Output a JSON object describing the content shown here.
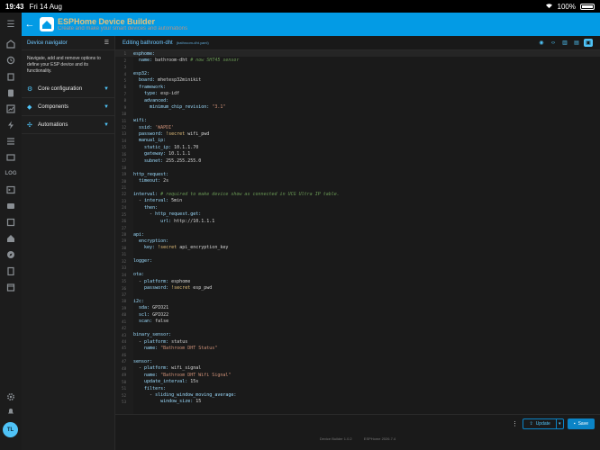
{
  "status": {
    "time": "19:43",
    "date": "Fri 14 Aug",
    "battery": "100%"
  },
  "header": {
    "title": "ESPHome Device Builder",
    "subtitle": "Create and make your smart devices and automations"
  },
  "nav": {
    "title": "Device navigator",
    "description": "Navigate, add and remove options to define your ESP device and its functionality.",
    "items": [
      {
        "label": "Core configuration"
      },
      {
        "label": "Components"
      },
      {
        "label": "Automations"
      }
    ]
  },
  "editor": {
    "title": "Editing bathroom-dht",
    "file": "(bathroom-dht.yaml)"
  },
  "footer": {
    "update_label": "Update",
    "save_label": "Save",
    "builder_version": "Device Builder 1.0.2",
    "esphome_version": "ESPHome 2026.7.4"
  },
  "user": {
    "initials": "TL"
  },
  "code_lines": [
    [
      [
        "k",
        "esphome:"
      ]
    ],
    [
      [
        "k",
        "  name: "
      ],
      [
        "v",
        "bathroom-dht "
      ],
      [
        "c",
        "# now SHT45 sensor"
      ]
    ],
    [],
    [
      [
        "k",
        "esp32:"
      ]
    ],
    [
      [
        "k",
        "  board: "
      ],
      [
        "v",
        "mhetesp32minikit"
      ]
    ],
    [
      [
        "k",
        "  framework:"
      ]
    ],
    [
      [
        "k",
        "    type: "
      ],
      [
        "v",
        "esp-idf"
      ]
    ],
    [
      [
        "k",
        "    advanced:"
      ]
    ],
    [
      [
        "k",
        "      minimum_chip_revision: "
      ],
      [
        "s",
        "\"3.1\""
      ]
    ],
    [],
    [
      [
        "k",
        "wifi:"
      ]
    ],
    [
      [
        "k",
        "  ssid: "
      ],
      [
        "s",
        "'WAPDI'"
      ]
    ],
    [
      [
        "k",
        "  password: "
      ],
      [
        "t",
        "!secret "
      ],
      [
        "v",
        "wifi_pwd"
      ]
    ],
    [
      [
        "k",
        "  manual_ip:"
      ]
    ],
    [
      [
        "k",
        "    static_ip: "
      ],
      [
        "v",
        "10.1.1.70"
      ]
    ],
    [
      [
        "k",
        "    gateway: "
      ],
      [
        "v",
        "10.1.1.1"
      ]
    ],
    [
      [
        "k",
        "    subnet: "
      ],
      [
        "v",
        "255.255.255.0"
      ]
    ],
    [],
    [
      [
        "k",
        "http_request:"
      ]
    ],
    [
      [
        "k",
        "  timeout: "
      ],
      [
        "v",
        "2s"
      ]
    ],
    [],
    [
      [
        "k",
        "interval: "
      ],
      [
        "c",
        "# required to make device show as connected in UCG Ultra IP table."
      ]
    ],
    [
      [
        "v",
        "  - "
      ],
      [
        "k",
        "interval: "
      ],
      [
        "v",
        "5min"
      ]
    ],
    [
      [
        "k",
        "    then:"
      ]
    ],
    [
      [
        "v",
        "      - "
      ],
      [
        "k",
        "http_request.get:"
      ]
    ],
    [
      [
        "k",
        "          url: "
      ],
      [
        "v",
        "http://10.1.1.1"
      ]
    ],
    [],
    [
      [
        "k",
        "api:"
      ]
    ],
    [
      [
        "k",
        "  encryption:"
      ]
    ],
    [
      [
        "k",
        "    key: "
      ],
      [
        "t",
        "!secret "
      ],
      [
        "v",
        "api_encryption_key"
      ]
    ],
    [],
    [
      [
        "k",
        "logger:"
      ]
    ],
    [],
    [
      [
        "k",
        "ota:"
      ]
    ],
    [
      [
        "v",
        "  - "
      ],
      [
        "k",
        "platform: "
      ],
      [
        "v",
        "esphome"
      ]
    ],
    [
      [
        "k",
        "    password: "
      ],
      [
        "t",
        "!secret "
      ],
      [
        "v",
        "esp_pwd"
      ]
    ],
    [],
    [
      [
        "k",
        "i2c:"
      ]
    ],
    [
      [
        "k",
        "  sda: "
      ],
      [
        "v",
        "GPIO21"
      ]
    ],
    [
      [
        "k",
        "  scl: "
      ],
      [
        "v",
        "GPIO22"
      ]
    ],
    [
      [
        "k",
        "  scan: "
      ],
      [
        "v",
        "false"
      ]
    ],
    [],
    [
      [
        "k",
        "binary_sensor:"
      ]
    ],
    [
      [
        "v",
        "  - "
      ],
      [
        "k",
        "platform: "
      ],
      [
        "v",
        "status"
      ]
    ],
    [
      [
        "k",
        "    name: "
      ],
      [
        "s",
        "\"Bathroom DHT Status\""
      ]
    ],
    [],
    [
      [
        "k",
        "sensor:"
      ]
    ],
    [
      [
        "v",
        "  - "
      ],
      [
        "k",
        "platform: "
      ],
      [
        "v",
        "wifi_signal"
      ]
    ],
    [
      [
        "k",
        "    name: "
      ],
      [
        "s",
        "\"Bathroom DHT Wifi Signal\""
      ]
    ],
    [
      [
        "k",
        "    update_interval: "
      ],
      [
        "v",
        "15s"
      ]
    ],
    [
      [
        "k",
        "    filters:"
      ]
    ],
    [
      [
        "v",
        "      - "
      ],
      [
        "k",
        "sliding_window_moving_average:"
      ]
    ],
    [
      [
        "k",
        "          window_size: "
      ],
      [
        "v",
        "15"
      ]
    ]
  ]
}
